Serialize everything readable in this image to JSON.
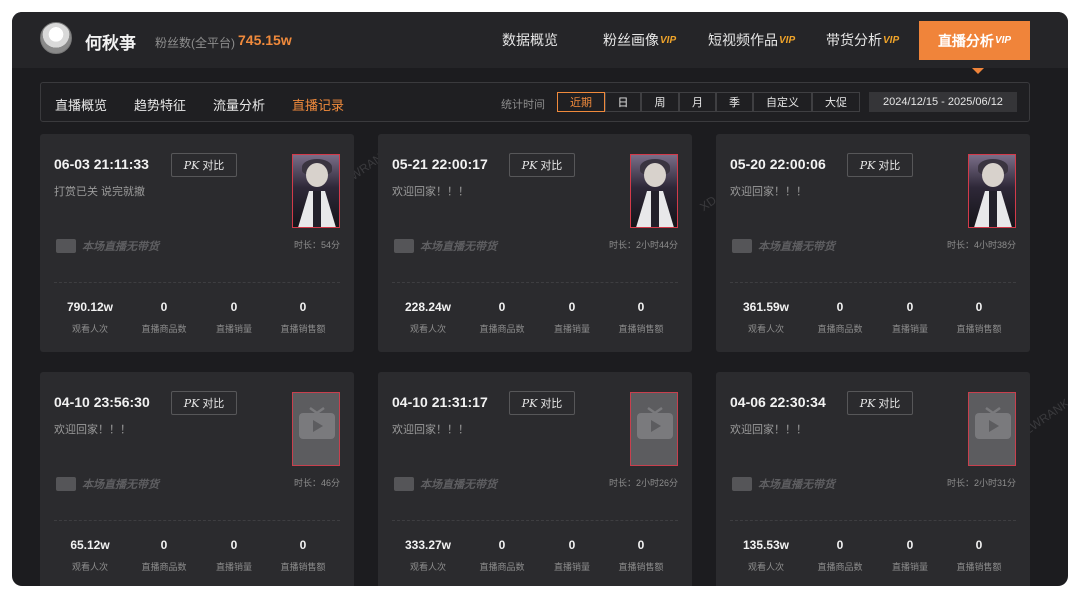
{
  "header": {
    "username": "何秋亊",
    "fans_label": "粉丝数(全平台)",
    "fans_value": "745.15w",
    "nav": [
      {
        "label": "数据概览",
        "vip": ""
      },
      {
        "label": "粉丝画像",
        "vip": "VIP"
      },
      {
        "label": "短视频作品",
        "vip": "VIP"
      },
      {
        "label": "带货分析",
        "vip": "VIP"
      },
      {
        "label": "直播分析",
        "vip": "VIP"
      }
    ]
  },
  "subnav": {
    "tabs": [
      "直播概览",
      "趋势特征",
      "流量分析",
      "直播记录"
    ],
    "stat_label": "统计时间",
    "periods": [
      "近期",
      "日",
      "周",
      "月",
      "季",
      "自定义",
      "大促"
    ],
    "date_range": "2024/12/15 - 2025/06/12"
  },
  "card_common": {
    "pk_prefix": "PK",
    "pk_label": "对比",
    "no_goods": "本场直播无带货",
    "stat_labels": [
      "观看人次",
      "直播商品数",
      "直播销量",
      "直播销售额"
    ]
  },
  "watermark": "XD.NEWRANK.CN",
  "cards": [
    {
      "time": "06-03 21:11:33",
      "desc": "打赏已关 说完就撤",
      "duration": "时长：54分",
      "thumb": "photo",
      "stats": [
        "790.12w",
        "0",
        "0",
        "0"
      ]
    },
    {
      "time": "05-21 22:00:17",
      "desc": "欢迎回家！！！",
      "duration": "时长：2小时44分",
      "thumb": "photo",
      "stats": [
        "228.24w",
        "0",
        "0",
        "0"
      ]
    },
    {
      "time": "05-20 22:00:06",
      "desc": "欢迎回家！！！",
      "duration": "时长：4小时38分",
      "thumb": "photo",
      "stats": [
        "361.59w",
        "0",
        "0",
        "0"
      ]
    },
    {
      "time": "04-10 23:56:30",
      "desc": "欢迎回家！！！",
      "duration": "时长：46分",
      "thumb": "placeholder",
      "stats": [
        "65.12w",
        "0",
        "0",
        "0"
      ]
    },
    {
      "time": "04-10 21:31:17",
      "desc": "欢迎回家！！！",
      "duration": "时长：2小时26分",
      "thumb": "placeholder",
      "stats": [
        "333.27w",
        "0",
        "0",
        "0"
      ]
    },
    {
      "time": "04-06 22:30:34",
      "desc": "欢迎回家！！！",
      "duration": "时长：2小时31分",
      "thumb": "placeholder",
      "stats": [
        "135.53w",
        "0",
        "0",
        "0"
      ]
    }
  ]
}
